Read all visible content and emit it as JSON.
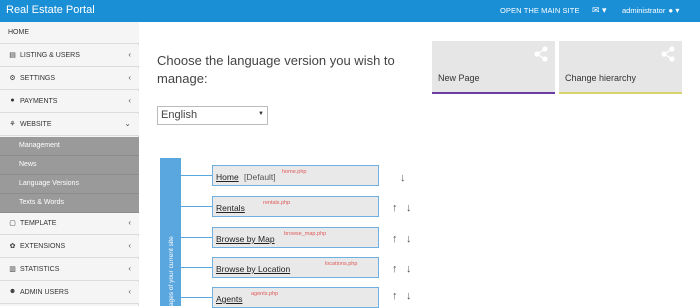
{
  "header": {
    "brand": "Real Estate Portal",
    "open_site": "OPEN THE MAIN SITE",
    "mail_icon": "✉ ▾",
    "user": "administrator"
  },
  "sidebar": {
    "items": [
      {
        "label": "HOME",
        "icon": ""
      },
      {
        "label": "LISTING & USERS",
        "icon": "▤"
      },
      {
        "label": "SETTINGS",
        "icon": "⚙"
      },
      {
        "label": "PAYMENTS",
        "icon": "●"
      },
      {
        "label": "WEBSITE",
        "icon": "⚘"
      },
      {
        "label": "TEMPLATE",
        "icon": "▢"
      },
      {
        "label": "EXTENSIONS",
        "icon": "✿"
      },
      {
        "label": "STATISTICS",
        "icon": "▥"
      },
      {
        "label": "ADMIN USERS",
        "icon": "☻"
      }
    ],
    "website_sub": [
      "Management",
      "News",
      "Language Versions",
      "Texts & Words"
    ]
  },
  "main": {
    "heading": "Choose the language version you wish to manage:",
    "language": "English",
    "tiles": [
      {
        "label": "New Page",
        "accent": "#6b3fa0"
      },
      {
        "label": "Change hierarchy",
        "accent": "#d8d36a"
      }
    ],
    "tree_label": "ages of your current site",
    "pages": [
      {
        "name": "Home",
        "default": "[Default]",
        "file": "home.php"
      },
      {
        "name": "Rentals",
        "default": "",
        "file": "rentals.php"
      },
      {
        "name": "Browse by Map",
        "default": "",
        "file": "browse_map.php"
      },
      {
        "name": "Browse by Location",
        "default": "",
        "file": "locations.php"
      },
      {
        "name": "Agents",
        "default": "",
        "file": "agents.php"
      }
    ]
  },
  "colors": {
    "topbar": "#1a8fd6",
    "tree": "#5aa6de",
    "file_label": "#e05a5a"
  }
}
